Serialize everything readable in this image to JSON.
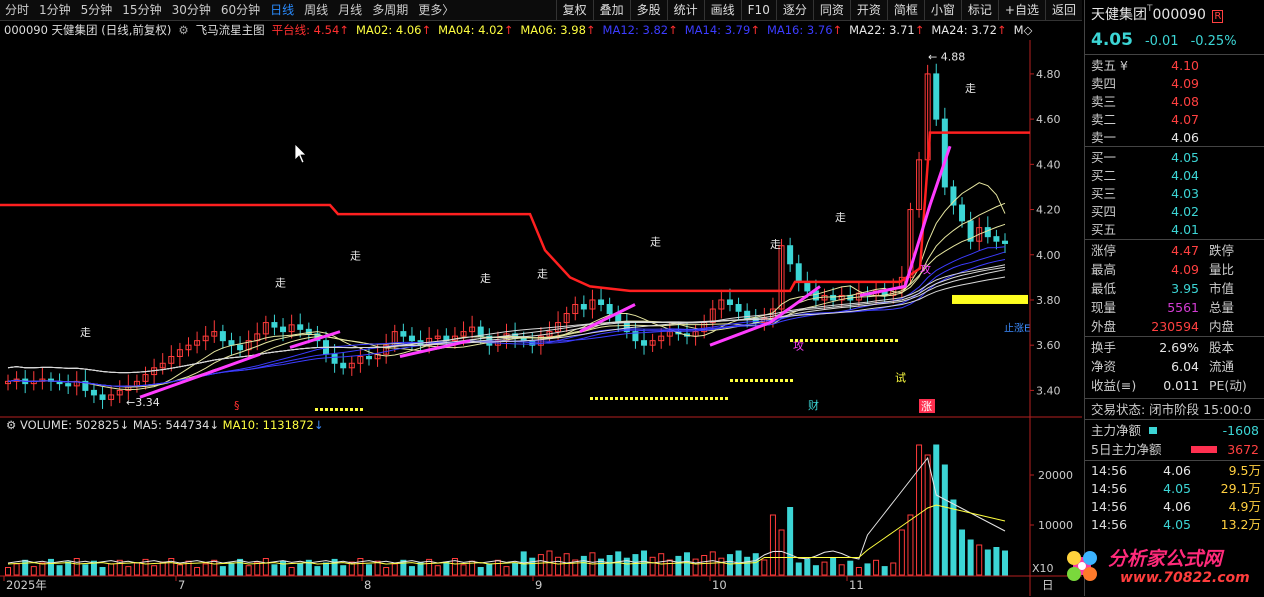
{
  "toolbar": {
    "periods": [
      "分时",
      "1分钟",
      "5分钟",
      "15分钟",
      "30分钟",
      "60分钟",
      "日线",
      "周线",
      "月线",
      "多周期",
      "更多〉"
    ],
    "active_period": "日线",
    "buttons": [
      "复权",
      "叠加",
      "多股",
      "统计",
      "画线",
      "F10",
      "逐分",
      "同资",
      "开资",
      "简框",
      "小窗",
      "标记",
      "+自选",
      "返回"
    ]
  },
  "indicator_bar": {
    "stock": "000090 天健集团 (日线,前复权)",
    "study": "飞马流星主图",
    "items": [
      {
        "label": "平台线: 4.54",
        "arrow": "↑",
        "color": "#ff3030"
      },
      {
        "label": "MA02: 4.06",
        "arrow": "↑",
        "color": "#ffff40"
      },
      {
        "label": "MA04: 4.02",
        "arrow": "↑",
        "color": "#ffff40"
      },
      {
        "label": "MA06: 3.98",
        "arrow": "↑",
        "color": "#ffff40"
      },
      {
        "label": "MA12: 3.82",
        "arrow": "↑",
        "color": "#3c3cff"
      },
      {
        "label": "MA14: 3.79",
        "arrow": "↑",
        "color": "#3c3cff"
      },
      {
        "label": "MA16: 3.76",
        "arrow": "↑",
        "color": "#3c3cff"
      },
      {
        "label": "MA22: 3.71",
        "arrow": "↑",
        "color": "#e6e6e6"
      },
      {
        "label": "MA24: 3.72",
        "arrow": "↑",
        "color": "#e6e6e6"
      },
      {
        "label": "M◇",
        "arrow": "",
        "color": "#e6e6e6"
      }
    ]
  },
  "price_axis": [
    "4.80",
    "4.60",
    "4.40",
    "4.20",
    "4.00",
    "3.80",
    "3.60",
    "3.40"
  ],
  "volume_axis": [
    "20000",
    "10000"
  ],
  "volume_unit": "X10",
  "volume_bar": {
    "label": "VOLUME: 502825",
    "ma5": "MA5: 544734",
    "ma10": "MA10: 1131872"
  },
  "date_axis": [
    "2025年",
    "7",
    "8",
    "9",
    "10",
    "11"
  ],
  "date_corner": "日",
  "annotations": {
    "high": "4.88",
    "low": "3.34",
    "walk": "走",
    "attack": "攻",
    "test": "试",
    "finance": "财",
    "rise": "涨",
    "s_mark": "§",
    "stop_rise": "止涨E"
  },
  "chart_data": {
    "type": "candlestick",
    "ylim": [
      3.3,
      4.95
    ],
    "platform_line_current": 4.54,
    "candles_close": [
      3.44,
      3.45,
      3.43,
      3.44,
      3.45,
      3.44,
      3.43,
      3.42,
      3.44,
      3.4,
      3.38,
      3.36,
      3.38,
      3.4,
      3.42,
      3.44,
      3.47,
      3.5,
      3.52,
      3.55,
      3.58,
      3.6,
      3.62,
      3.64,
      3.66,
      3.62,
      3.6,
      3.58,
      3.62,
      3.65,
      3.7,
      3.68,
      3.66,
      3.69,
      3.67,
      3.65,
      3.62,
      3.56,
      3.52,
      3.5,
      3.52,
      3.55,
      3.54,
      3.56,
      3.6,
      3.66,
      3.64,
      3.62,
      3.6,
      3.63,
      3.64,
      3.62,
      3.64,
      3.66,
      3.68,
      3.64,
      3.6,
      3.62,
      3.65,
      3.63,
      3.62,
      3.6,
      3.64,
      3.66,
      3.7,
      3.74,
      3.78,
      3.76,
      3.8,
      3.78,
      3.74,
      3.7,
      3.66,
      3.62,
      3.6,
      3.62,
      3.64,
      3.66,
      3.65,
      3.64,
      3.66,
      3.7,
      3.76,
      3.8,
      3.78,
      3.75,
      3.72,
      3.7,
      3.72,
      3.76,
      4.04,
      3.96,
      3.88,
      3.84,
      3.8,
      3.82,
      3.8,
      3.82,
      3.8,
      3.83,
      3.82,
      3.84,
      3.82,
      3.85,
      3.9,
      4.2,
      4.42,
      4.8,
      4.6,
      4.3,
      4.22,
      4.15,
      4.06,
      4.12,
      4.08,
      4.06,
      4.05
    ]
  },
  "panel": {
    "name": "天健集团",
    "code": "000090",
    "tag": "R",
    "price": "4.05",
    "change": "-0.01",
    "pct": "-0.25%",
    "asks": [
      {
        "label": "卖五 ¥",
        "price": "4.10",
        "color": "red"
      },
      {
        "label": "卖四",
        "price": "4.09",
        "color": "red"
      },
      {
        "label": "卖三",
        "price": "4.08",
        "color": "red"
      },
      {
        "label": "卖二",
        "price": "4.07",
        "color": "red"
      },
      {
        "label": "卖一",
        "price": "4.06",
        "color": "white"
      }
    ],
    "bids": [
      {
        "label": "买一",
        "price": "4.05",
        "color": "cyan"
      },
      {
        "label": "买二",
        "price": "4.04",
        "color": "cyan"
      },
      {
        "label": "买三",
        "price": "4.03",
        "color": "cyan"
      },
      {
        "label": "买四",
        "price": "4.02",
        "color": "cyan"
      },
      {
        "label": "买五",
        "price": "4.01",
        "color": "cyan"
      }
    ],
    "stats": [
      {
        "l": "涨停",
        "v": "4.47",
        "c": "red",
        "l2": "跌停"
      },
      {
        "l": "最高",
        "v": "4.09",
        "c": "red",
        "l2": "量比"
      },
      {
        "l": "最低",
        "v": "3.95",
        "c": "cyan",
        "l2": "市值"
      },
      {
        "l": "现量",
        "v": "5561",
        "c": "mag",
        "l2": "总量"
      },
      {
        "l": "外盘",
        "v": "230594",
        "c": "red",
        "l2": "内盘"
      }
    ],
    "finance": [
      {
        "l": "换手",
        "v": "2.69%",
        "c": "white",
        "l2": "股本"
      },
      {
        "l": "净资",
        "v": "6.04",
        "c": "white",
        "l2": "流通"
      },
      {
        "l": "收益(≡)",
        "v": "0.011",
        "c": "white",
        "l2": "PE(动)"
      }
    ],
    "trade_status": "交易状态: 闭市阶段 15:00:0",
    "main_net": {
      "label": "主力净额",
      "value": "-1608"
    },
    "main_net5": {
      "label": "5日主力净额",
      "value": "3672"
    },
    "ticks": [
      {
        "t": "14:56",
        "p": "4.06",
        "pc": "white",
        "v": "9.5万",
        "vc": "#ffcf40"
      },
      {
        "t": "14:56",
        "p": "4.05",
        "pc": "cyan",
        "v": "29.1万",
        "vc": "#ffcf40"
      },
      {
        "t": "14:56",
        "p": "4.06",
        "pc": "white",
        "v": "4.9万",
        "vc": "#ffcf40"
      },
      {
        "t": "14:56",
        "p": "4.05",
        "pc": "cyan",
        "v": "13.2万",
        "vc": "#ffcf40"
      }
    ]
  },
  "watermark": {
    "title": "分析家公式网",
    "url": "www.70822.com"
  }
}
